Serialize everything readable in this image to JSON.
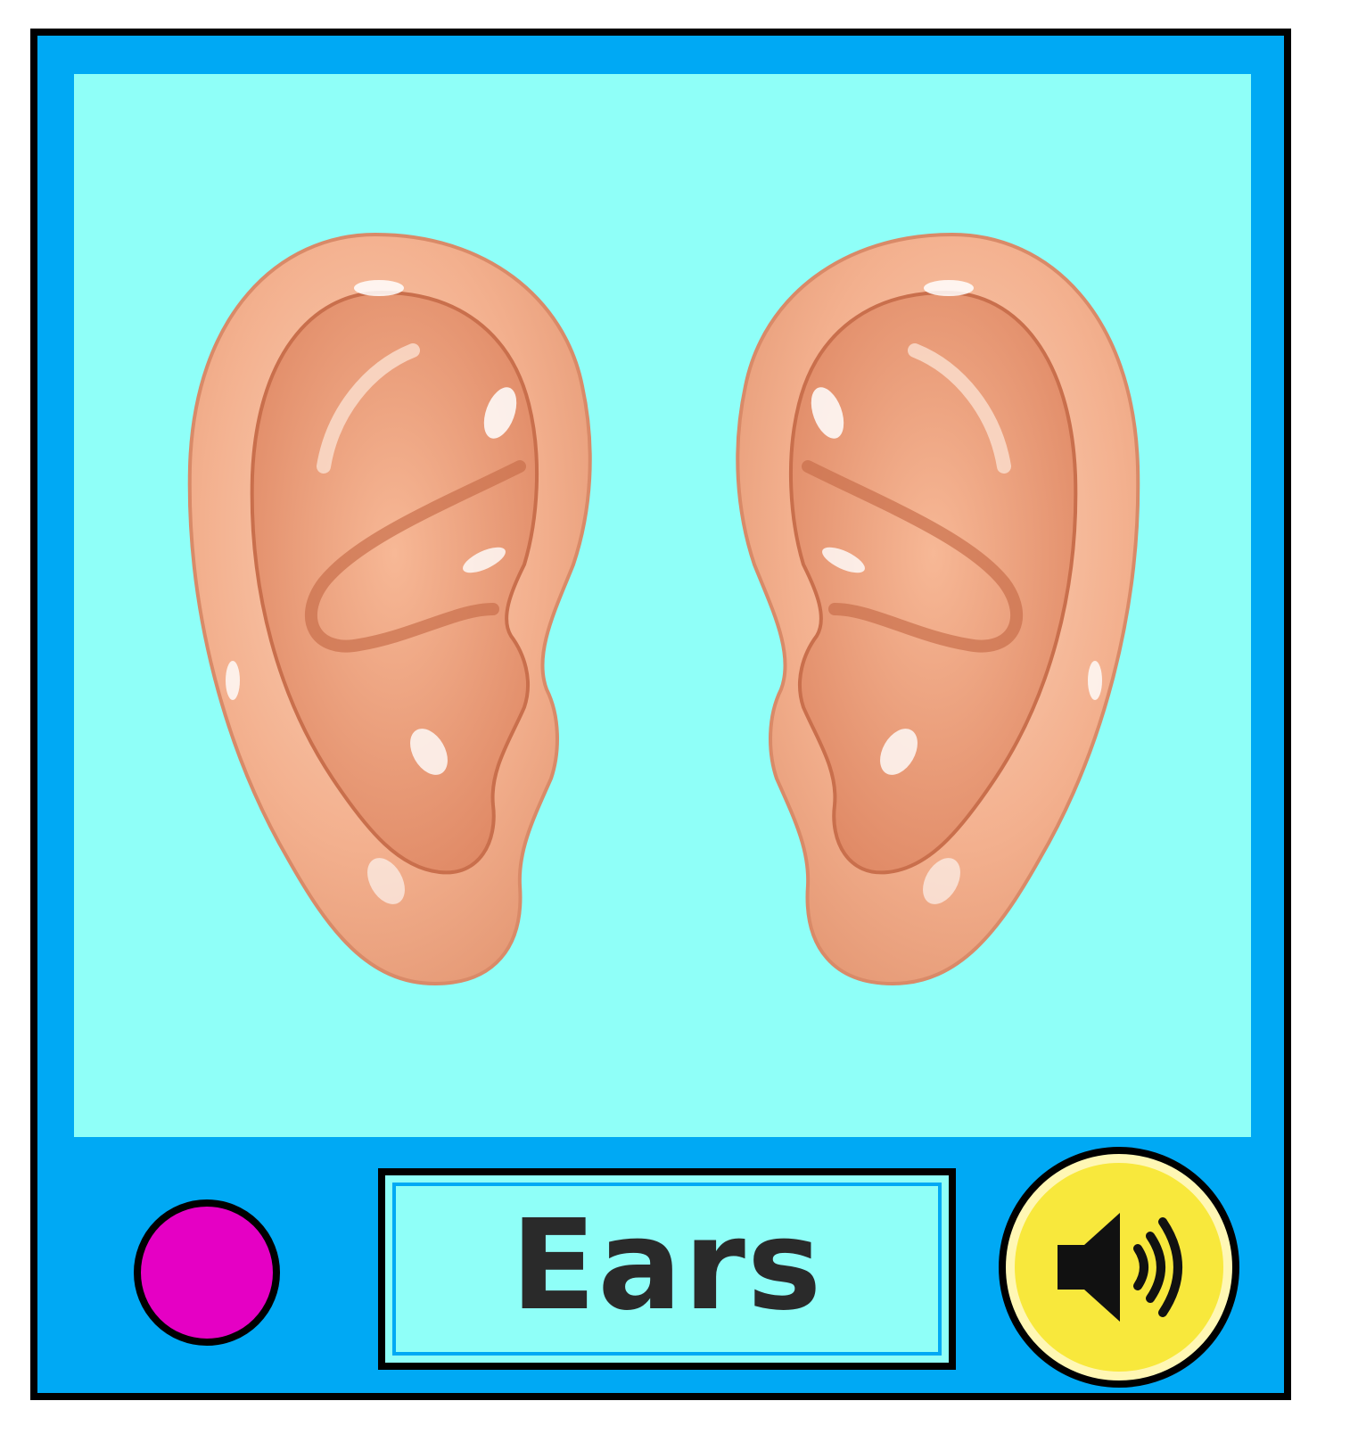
{
  "card": {
    "word": "Ears",
    "picture_subject": "pair-of-ears-icon",
    "colors": {
      "frame": "#00a9f4",
      "picture_background": "#8ffff8",
      "dot": "#e500c4",
      "speaker_button": "#f8e83c",
      "skin": "#f5b89a"
    }
  },
  "controls": {
    "dot_icon": "pink-dot-icon",
    "sound_icon": "speaker-volume-icon"
  }
}
